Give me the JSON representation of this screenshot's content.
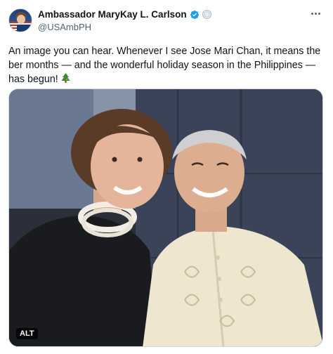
{
  "author": {
    "display_name": "Ambassador MaryKay L. Carlson",
    "handle": "@USAmbPH",
    "verified_icon": "verified-badge-icon",
    "affiliation_icon": "government-seal-icon"
  },
  "menu": {
    "icon": "more-options-icon"
  },
  "tweet": {
    "text": "An image you can hear. Whenever I see Jose Mari Chan, it means the ber months — and the wonderful holiday season in the Philippines — has begun!",
    "emoji_icon": "christmas-tree-icon"
  },
  "media": {
    "alt_label": "ALT"
  },
  "colors": {
    "text": "#0f1419",
    "secondary_text": "#536471",
    "verified_blue": "#1d9bf0"
  }
}
